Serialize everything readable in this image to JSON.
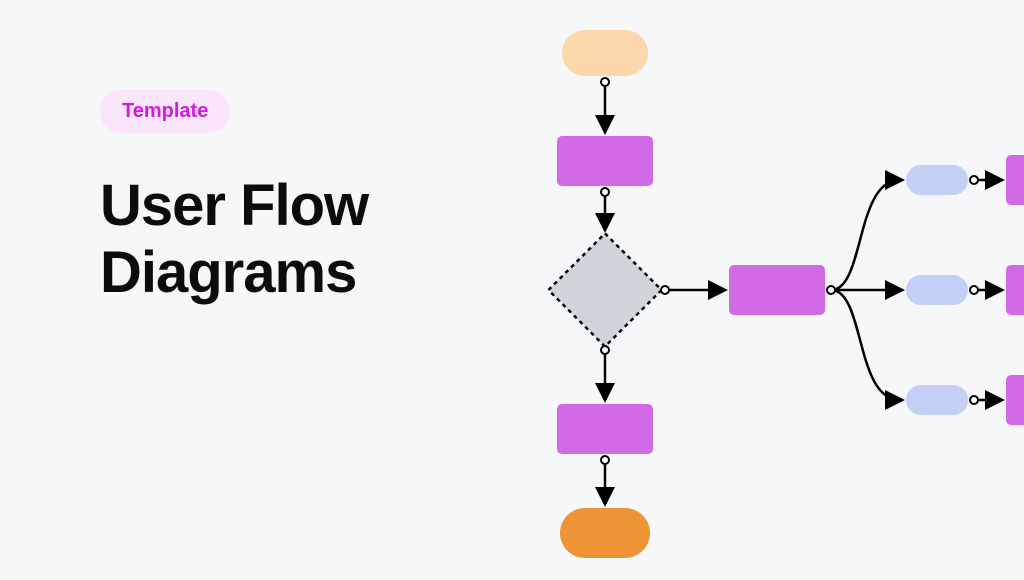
{
  "badge_label": "Template",
  "title_line1": "User Flow",
  "title_line2": "Diagrams",
  "colors": {
    "background": "#F6F7F9",
    "badge_bg": "#FAE5FB",
    "badge_text": "#D21BE0",
    "title_text": "#0B0C0D",
    "node_start": "#FBD7AB",
    "node_process": "#D269E6",
    "node_decision_fill": "#D0D4DB",
    "node_end": "#EF9337",
    "node_sub": "#C3CFF4",
    "stroke": "#000000"
  },
  "diagram": {
    "nodes": [
      {
        "id": "start",
        "type": "terminator",
        "fill": "node_start"
      },
      {
        "id": "p1",
        "type": "process",
        "fill": "node_process"
      },
      {
        "id": "decision",
        "type": "decision",
        "fill": "node_decision_fill"
      },
      {
        "id": "p2",
        "type": "process",
        "fill": "node_process"
      },
      {
        "id": "end",
        "type": "terminator",
        "fill": "node_end"
      },
      {
        "id": "p3",
        "type": "process",
        "fill": "node_process"
      },
      {
        "id": "s1",
        "type": "sub",
        "fill": "node_sub"
      },
      {
        "id": "s2",
        "type": "sub",
        "fill": "node_sub"
      },
      {
        "id": "s3",
        "type": "sub",
        "fill": "node_sub"
      },
      {
        "id": "r1",
        "type": "process",
        "fill": "node_process"
      },
      {
        "id": "r2",
        "type": "process",
        "fill": "node_process"
      },
      {
        "id": "r3",
        "type": "process",
        "fill": "node_process"
      }
    ],
    "edges": [
      {
        "from": "start",
        "to": "p1"
      },
      {
        "from": "p1",
        "to": "decision"
      },
      {
        "from": "decision",
        "to": "p2"
      },
      {
        "from": "p2",
        "to": "end"
      },
      {
        "from": "decision",
        "to": "p3"
      },
      {
        "from": "p3",
        "to": "s1"
      },
      {
        "from": "p3",
        "to": "s2"
      },
      {
        "from": "p3",
        "to": "s3"
      },
      {
        "from": "s1",
        "to": "r1"
      },
      {
        "from": "s2",
        "to": "r2"
      },
      {
        "from": "s3",
        "to": "r3"
      }
    ]
  }
}
